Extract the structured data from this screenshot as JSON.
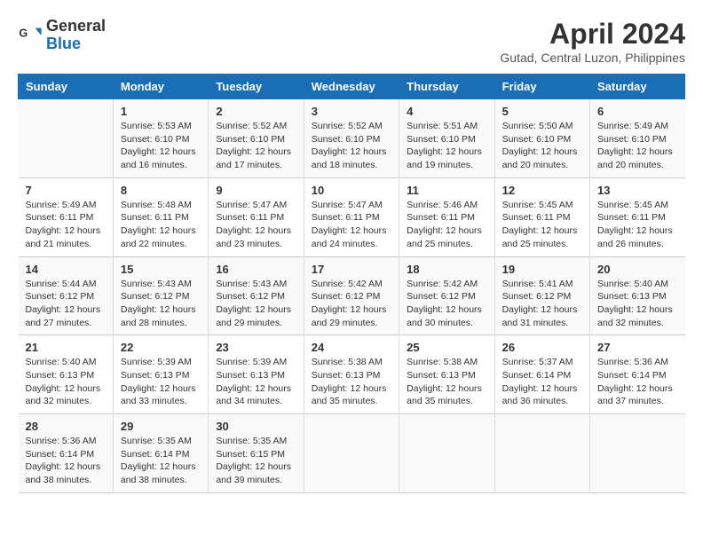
{
  "app": {
    "name": "GeneralBlue",
    "logo_text_line1": "General",
    "logo_text_line2": "Blue"
  },
  "calendar": {
    "month_year": "April 2024",
    "location": "Gutad, Central Luzon, Philippines",
    "days_of_week": [
      "Sunday",
      "Monday",
      "Tuesday",
      "Wednesday",
      "Thursday",
      "Friday",
      "Saturday"
    ],
    "weeks": [
      [
        {
          "day": "",
          "info": ""
        },
        {
          "day": "1",
          "info": "Sunrise: 5:53 AM\nSunset: 6:10 PM\nDaylight: 12 hours\nand 16 minutes."
        },
        {
          "day": "2",
          "info": "Sunrise: 5:52 AM\nSunset: 6:10 PM\nDaylight: 12 hours\nand 17 minutes."
        },
        {
          "day": "3",
          "info": "Sunrise: 5:52 AM\nSunset: 6:10 PM\nDaylight: 12 hours\nand 18 minutes."
        },
        {
          "day": "4",
          "info": "Sunrise: 5:51 AM\nSunset: 6:10 PM\nDaylight: 12 hours\nand 19 minutes."
        },
        {
          "day": "5",
          "info": "Sunrise: 5:50 AM\nSunset: 6:10 PM\nDaylight: 12 hours\nand 20 minutes."
        },
        {
          "day": "6",
          "info": "Sunrise: 5:49 AM\nSunset: 6:10 PM\nDaylight: 12 hours\nand 20 minutes."
        }
      ],
      [
        {
          "day": "7",
          "info": "Sunrise: 5:49 AM\nSunset: 6:11 PM\nDaylight: 12 hours\nand 21 minutes."
        },
        {
          "day": "8",
          "info": "Sunrise: 5:48 AM\nSunset: 6:11 PM\nDaylight: 12 hours\nand 22 minutes."
        },
        {
          "day": "9",
          "info": "Sunrise: 5:47 AM\nSunset: 6:11 PM\nDaylight: 12 hours\nand 23 minutes."
        },
        {
          "day": "10",
          "info": "Sunrise: 5:47 AM\nSunset: 6:11 PM\nDaylight: 12 hours\nand 24 minutes."
        },
        {
          "day": "11",
          "info": "Sunrise: 5:46 AM\nSunset: 6:11 PM\nDaylight: 12 hours\nand 25 minutes."
        },
        {
          "day": "12",
          "info": "Sunrise: 5:45 AM\nSunset: 6:11 PM\nDaylight: 12 hours\nand 25 minutes."
        },
        {
          "day": "13",
          "info": "Sunrise: 5:45 AM\nSunset: 6:11 PM\nDaylight: 12 hours\nand 26 minutes."
        }
      ],
      [
        {
          "day": "14",
          "info": "Sunrise: 5:44 AM\nSunset: 6:12 PM\nDaylight: 12 hours\nand 27 minutes."
        },
        {
          "day": "15",
          "info": "Sunrise: 5:43 AM\nSunset: 6:12 PM\nDaylight: 12 hours\nand 28 minutes."
        },
        {
          "day": "16",
          "info": "Sunrise: 5:43 AM\nSunset: 6:12 PM\nDaylight: 12 hours\nand 29 minutes."
        },
        {
          "day": "17",
          "info": "Sunrise: 5:42 AM\nSunset: 6:12 PM\nDaylight: 12 hours\nand 29 minutes."
        },
        {
          "day": "18",
          "info": "Sunrise: 5:42 AM\nSunset: 6:12 PM\nDaylight: 12 hours\nand 30 minutes."
        },
        {
          "day": "19",
          "info": "Sunrise: 5:41 AM\nSunset: 6:12 PM\nDaylight: 12 hours\nand 31 minutes."
        },
        {
          "day": "20",
          "info": "Sunrise: 5:40 AM\nSunset: 6:13 PM\nDaylight: 12 hours\nand 32 minutes."
        }
      ],
      [
        {
          "day": "21",
          "info": "Sunrise: 5:40 AM\nSunset: 6:13 PM\nDaylight: 12 hours\nand 32 minutes."
        },
        {
          "day": "22",
          "info": "Sunrise: 5:39 AM\nSunset: 6:13 PM\nDaylight: 12 hours\nand 33 minutes."
        },
        {
          "day": "23",
          "info": "Sunrise: 5:39 AM\nSunset: 6:13 PM\nDaylight: 12 hours\nand 34 minutes."
        },
        {
          "day": "24",
          "info": "Sunrise: 5:38 AM\nSunset: 6:13 PM\nDaylight: 12 hours\nand 35 minutes."
        },
        {
          "day": "25",
          "info": "Sunrise: 5:38 AM\nSunset: 6:13 PM\nDaylight: 12 hours\nand 35 minutes."
        },
        {
          "day": "26",
          "info": "Sunrise: 5:37 AM\nSunset: 6:14 PM\nDaylight: 12 hours\nand 36 minutes."
        },
        {
          "day": "27",
          "info": "Sunrise: 5:36 AM\nSunset: 6:14 PM\nDaylight: 12 hours\nand 37 minutes."
        }
      ],
      [
        {
          "day": "28",
          "info": "Sunrise: 5:36 AM\nSunset: 6:14 PM\nDaylight: 12 hours\nand 38 minutes."
        },
        {
          "day": "29",
          "info": "Sunrise: 5:35 AM\nSunset: 6:14 PM\nDaylight: 12 hours\nand 38 minutes."
        },
        {
          "day": "30",
          "info": "Sunrise: 5:35 AM\nSunset: 6:15 PM\nDaylight: 12 hours\nand 39 minutes."
        },
        {
          "day": "",
          "info": ""
        },
        {
          "day": "",
          "info": ""
        },
        {
          "day": "",
          "info": ""
        },
        {
          "day": "",
          "info": ""
        }
      ]
    ]
  }
}
